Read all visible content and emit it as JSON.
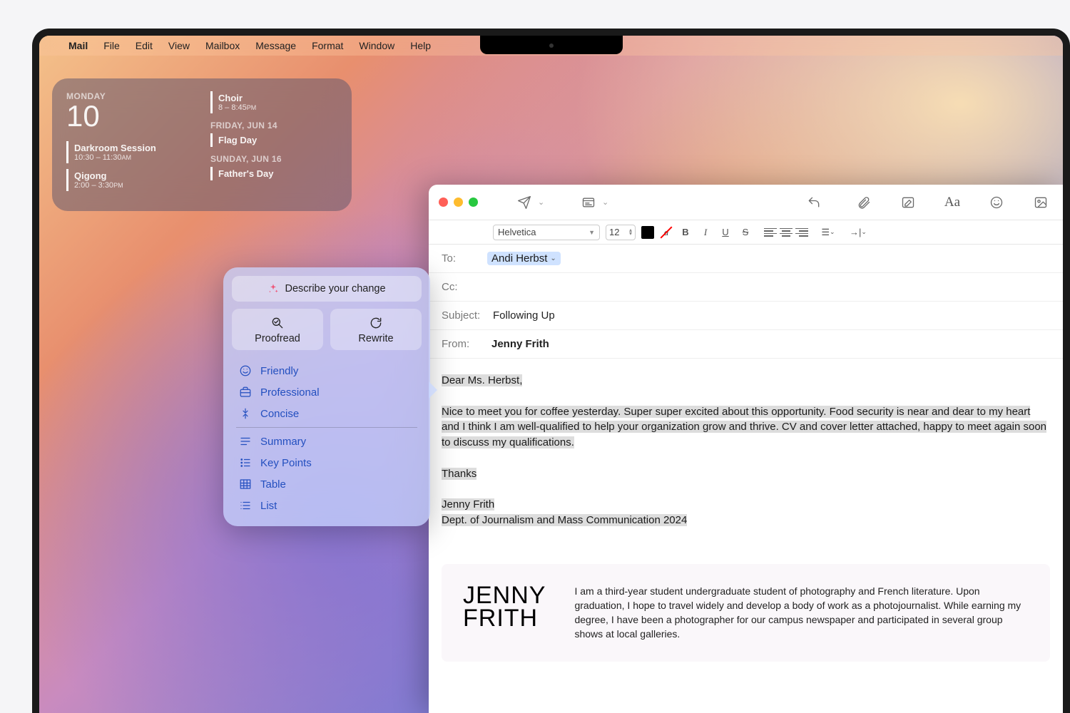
{
  "menubar": {
    "app": "Mail",
    "items": [
      "File",
      "Edit",
      "View",
      "Mailbox",
      "Message",
      "Format",
      "Window",
      "Help"
    ]
  },
  "calendar": {
    "day_label": "MONDAY",
    "day_num": "10",
    "left_events": [
      {
        "title": "Darkroom Session",
        "time": "10:30 – 11:30",
        "ampm": "AM"
      },
      {
        "title": "Qigong",
        "time": "2:00 – 3:30",
        "ampm": "PM"
      }
    ],
    "right_sections": [
      {
        "header": null,
        "events": [
          {
            "title": "Choir",
            "time": "8 – 8:45",
            "ampm": "PM"
          }
        ]
      },
      {
        "header": "FRIDAY, JUN 14",
        "events": [
          {
            "title": "Flag Day",
            "time": "",
            "ampm": ""
          }
        ]
      },
      {
        "header": "SUNDAY, JUN 16",
        "events": [
          {
            "title": "Father's Day",
            "time": "",
            "ampm": ""
          }
        ]
      }
    ]
  },
  "writing_tools": {
    "describe": "Describe your change",
    "proofread": "Proofread",
    "rewrite": "Rewrite",
    "tones": [
      "Friendly",
      "Professional",
      "Concise"
    ],
    "transforms": [
      "Summary",
      "Key Points",
      "Table",
      "List"
    ]
  },
  "mail": {
    "format": {
      "font": "Helvetica",
      "size": "12"
    },
    "to_label": "To:",
    "to_recipient": "Andi Herbst",
    "cc_label": "Cc:",
    "subject_label": "Subject:",
    "subject_value": "Following Up",
    "from_label": "From:",
    "from_value": "Jenny Frith",
    "body": {
      "greeting": "Dear Ms. Herbst,",
      "para": "Nice to meet you for coffee yesterday. Super super excited about this opportunity. Food security is near and dear to my heart and I think I am well-qualified to help your organization grow and thrive. CV and cover letter attached, happy to meet again soon to discuss my qualifications.",
      "thanks": "Thanks",
      "sig1": "Jenny Frith",
      "sig2": "Dept. of Journalism and Mass Communication 2024"
    },
    "sig_card": {
      "name1": "JENNY",
      "name2": "FRITH",
      "text": "I am a third-year student undergraduate student of photography and French literature. Upon graduation, I hope to travel widely and develop a body of work as a photojournalist. While earning my degree, I have been a photographer for our campus newspaper and participated in several group shows at local galleries."
    }
  }
}
